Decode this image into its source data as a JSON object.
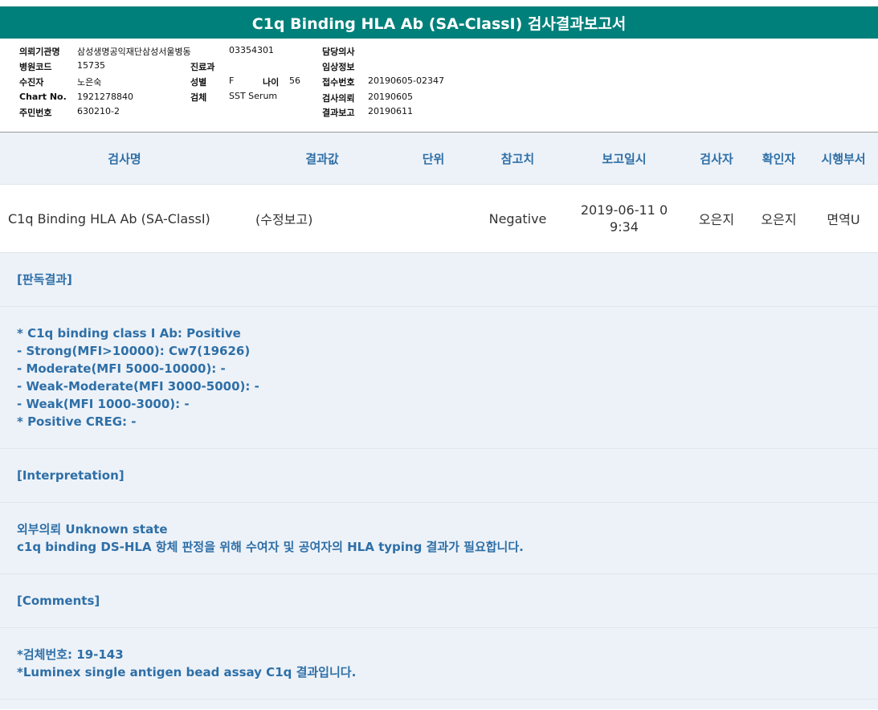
{
  "report": {
    "title": "C1q Binding HLA Ab (SA-ClassI) 검사결과보고서"
  },
  "patient_info": {
    "institution_label": "의뢰기관명",
    "institution_value": "삼성생명공익재단삼성서울병동",
    "institution_code": "03354301",
    "attending_label": "담당의사",
    "attending_value": "",
    "hospital_code_label": "병원코드",
    "hospital_code_value": "15735",
    "department_label": "진료과",
    "department_value": "",
    "clinical_info_label": "임상정보",
    "clinical_info_value": "",
    "examinee_label": "수진자",
    "examinee_value": "노은숙",
    "sex_label": "성별",
    "sex_value": "F",
    "age_label": "나이",
    "age_value": "56",
    "receipt_no_label": "접수번호",
    "receipt_no_value": "20190605-02347",
    "chart_no_label": "Chart No.",
    "chart_no_value": "1921278840",
    "specimen_label": "검체",
    "specimen_value": "SST Serum",
    "request_label": "검사의뢰",
    "request_value": "20190605",
    "resident_no_label": "주민번호",
    "resident_no_value": "630210-2",
    "report_label": "결과보고",
    "report_value": "20190611"
  },
  "table": {
    "headers": {
      "name": "검사명",
      "result": "결과값",
      "unit": "단위",
      "reference": "참고치",
      "report_date": "보고일시",
      "tester": "검사자",
      "confirmer": "확인자",
      "dept": "시행부서"
    },
    "row": {
      "name": "C1q Binding HLA Ab (SA-ClassI)",
      "result": "(수정보고)",
      "unit": "",
      "reference": "Negative",
      "report_date_line1": "2019-06-11 0",
      "report_date_line2": "9:34",
      "tester": "오은지",
      "confirmer": "오은지",
      "dept": "면역U"
    }
  },
  "sections": {
    "reading_header": "[판독결과]",
    "reading_lines": [
      "* C1q binding class I Ab: Positive",
      "- Strong(MFI>10000): Cw7(19626)",
      "- Moderate(MFI 5000-10000): -",
      "- Weak-Moderate(MFI 3000-5000): -",
      "- Weak(MFI 1000-3000): -",
      "* Positive CREG: -"
    ],
    "interpretation_header": "[Interpretation]",
    "interpretation_lines": [
      "외부의뢰 Unknown state",
      "c1q binding DS-HLA 항체 판정을 위해 수여자 및 공여자의 HLA typing 결과가 필요합니다."
    ],
    "comments_header": "[Comments]",
    "comments_lines": [
      "*검체번호: 19-143",
      "*Luminex single antigen bead assay C1q 결과입니다."
    ]
  },
  "colors": {
    "title_bar": "#00807a",
    "section_bg": "#edf2f8",
    "accent_text": "#2e6fa7"
  }
}
